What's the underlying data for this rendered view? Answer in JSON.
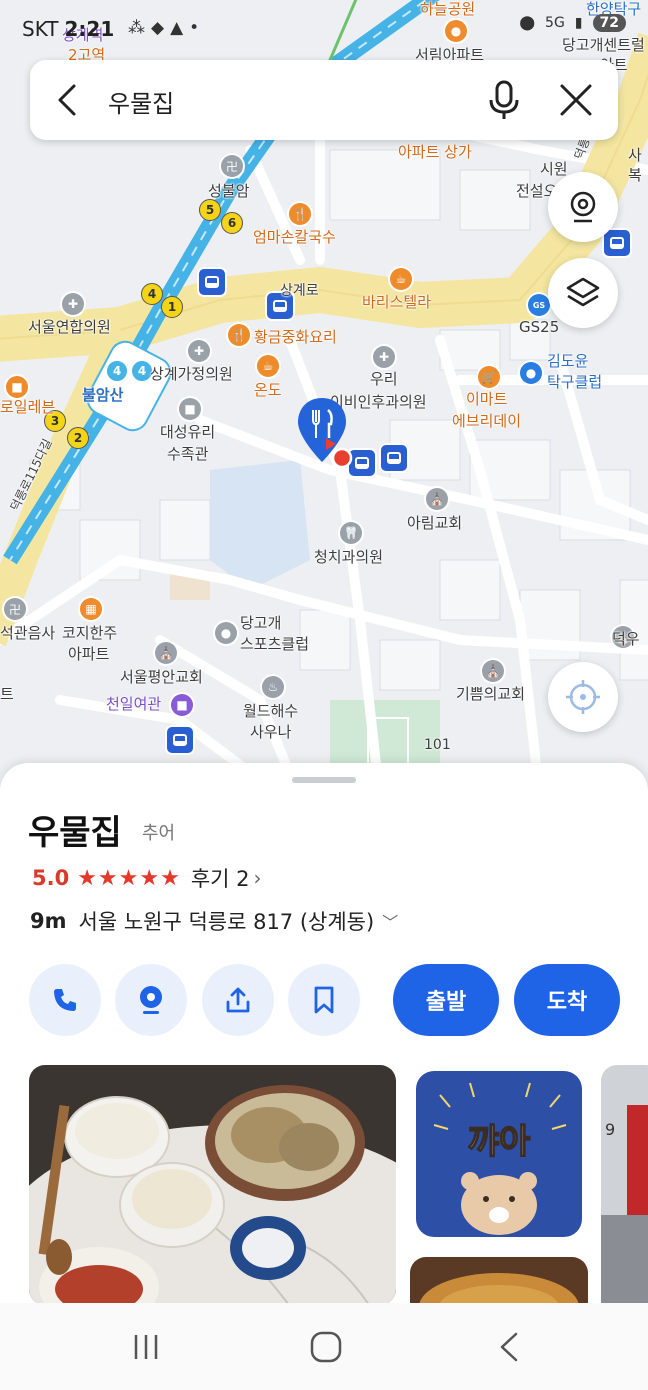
{
  "status_bar": {
    "carrier": "SKT",
    "time": "2:21",
    "battery": "72"
  },
  "search": {
    "query": "우물집"
  },
  "map_labels": {
    "top_park": "하늘공원",
    "top_station": "상계역",
    "top_station2": "2고역",
    "top_apartment": "서림아파트",
    "top_right1": "한양탁구",
    "top_right2": "당고개센트럴",
    "top_right3": "아트",
    "apt_mall": "아파트 상가",
    "market1": "시원",
    "market2": "전설오",
    "side1": "사",
    "side2": "복",
    "road_vertical": "덕릉로",
    "seongbulam": "성불암",
    "noodle": "엄마손칼국수",
    "sanggye_ro": "상계로",
    "barista": "바리스텔라",
    "gs25": "GS25",
    "seoul_union": "서울연합의원",
    "hwanggeum": "황금중화요리",
    "sanggye_family": "상계가정의원",
    "ondo": "온도",
    "woori_ent": "우리",
    "ent_clinic": "이비인후과의원",
    "emart": "이마트",
    "everyday": "에브리데이",
    "table_tennis1": "김도윤",
    "table_tennis2": "탁구클럽",
    "daesung1": "대성유리",
    "daesung2": "수족관",
    "left_cafe": "로일레븐",
    "arim": "아림교회",
    "dental": "청치과의원",
    "road_115": "덕릉로115다길",
    "temple": "석관음사",
    "kozy1": "코지한주",
    "kozy2": "아파트",
    "danggogae1": "당고개",
    "danggogae2": "스포츠클럽",
    "pyeongan": "서울평안교회",
    "cheonil": "천일여관",
    "world1": "월드해수",
    "world2": "사우나",
    "gippeum": "기쁨의교회",
    "right_edge": "덕우",
    "left_edge": "트",
    "num_101": "101",
    "station_name": "불암산"
  },
  "place": {
    "name": "우물집",
    "category": "추어",
    "score": "5.0",
    "stars": "★★★★★",
    "reviews": "후기 2",
    "distance": "9m",
    "address": "서울 노원구 덕릉로 817 (상계동)",
    "depart_label": "출발",
    "arrive_label": "도착"
  },
  "photo_text": {
    "sticker": "꺄아",
    "sign": "9"
  },
  "colors": {
    "accent": "#1f63e6",
    "rating": "#d83a2c",
    "subway_line": "#45b3e6",
    "main_road": "#f4e6a0"
  }
}
